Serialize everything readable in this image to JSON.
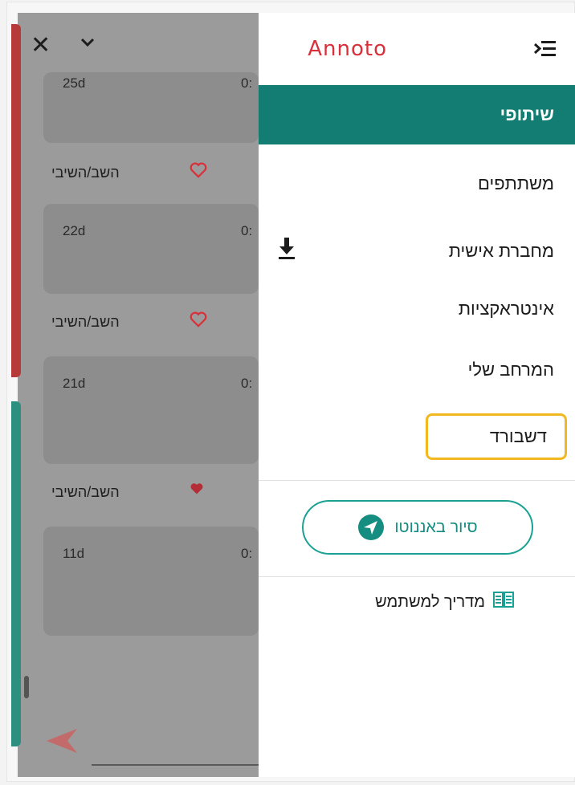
{
  "background": {
    "items": [
      {
        "age": "25d",
        "time": "0:",
        "name": "השב/השיבי",
        "liked": false
      },
      {
        "age": "22d",
        "time": "0:",
        "name": "השב/השיבי",
        "liked": false
      },
      {
        "age": "21d",
        "time": "0:",
        "name": "השב/השיבי",
        "liked": true
      },
      {
        "age": "11d",
        "time": "0:"
      }
    ],
    "close_icon": "close-icon",
    "chevron_icon": "chevron-down-icon"
  },
  "menu": {
    "logo": "Annoto",
    "toggle_icon": "menu-collapse-icon",
    "items": [
      {
        "label": "שיתופי",
        "active": true
      },
      {
        "label": "משתתפים"
      },
      {
        "label": "מחברת אישית",
        "icon": "download-icon"
      },
      {
        "label": "אינטראקציות"
      },
      {
        "label": "המרחב שלי"
      }
    ],
    "dashboard_label": "דשבורד",
    "tour_label": "סיור באננוטו",
    "tour_icon": "navigation-arrow-icon",
    "guide_label": "מדריך למשתמש",
    "guide_icon": "book-icon"
  },
  "colors": {
    "accent": "#147d73",
    "logo": "#d9313b",
    "highlight_border": "#f2b81f",
    "heart": "#d9313b"
  }
}
